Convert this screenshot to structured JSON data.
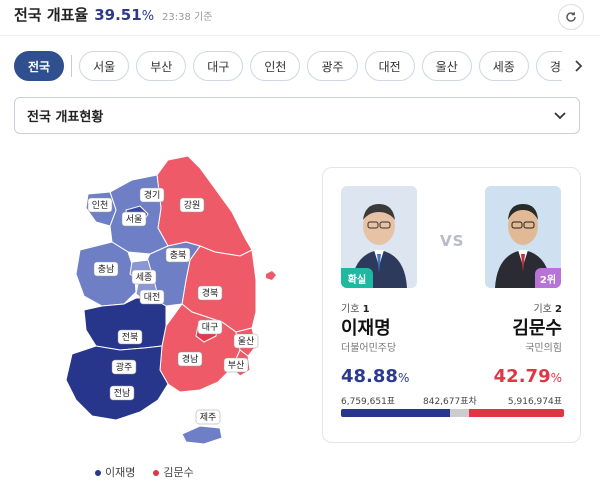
{
  "header": {
    "title": "전국 개표율",
    "rate": "39.51",
    "rate_unit": "%",
    "time": "23:38 기준"
  },
  "tabs": [
    {
      "label": "전국",
      "active": true
    },
    {
      "label": "서울"
    },
    {
      "label": "부산"
    },
    {
      "label": "대구"
    },
    {
      "label": "인천"
    },
    {
      "label": "광주"
    },
    {
      "label": "대전"
    },
    {
      "label": "울산"
    },
    {
      "label": "세종"
    },
    {
      "label": "경기"
    }
  ],
  "dropdown": {
    "label": "전국 개표현황"
  },
  "colors": {
    "blue": "#27368a",
    "blue_light": "#6e7fc6",
    "red": "#ee5a68",
    "red_light": "#f39aa3",
    "gray": "#cccccc"
  },
  "map": {
    "regions": [
      {
        "name": "인천",
        "winner": "blue"
      },
      {
        "name": "경기",
        "winner": "blue"
      },
      {
        "name": "서울",
        "winner": "blue"
      },
      {
        "name": "강원",
        "winner": "red"
      },
      {
        "name": "충남",
        "winner": "blue"
      },
      {
        "name": "세종",
        "winner": "blue"
      },
      {
        "name": "충북",
        "winner": "blue"
      },
      {
        "name": "대전",
        "winner": "blue"
      },
      {
        "name": "경북",
        "winner": "red"
      },
      {
        "name": "대구",
        "winner": "red"
      },
      {
        "name": "전북",
        "winner": "blue"
      },
      {
        "name": "울산",
        "winner": "red"
      },
      {
        "name": "광주",
        "winner": "blue"
      },
      {
        "name": "경남",
        "winner": "red"
      },
      {
        "name": "부산",
        "winner": "red"
      },
      {
        "name": "전남",
        "winner": "blue"
      },
      {
        "name": "제주",
        "winner": "blue"
      }
    ]
  },
  "legend": [
    {
      "label": "이재명",
      "color": "#27368a"
    },
    {
      "label": "김문수",
      "color": "#e03545"
    }
  ],
  "candidates": {
    "left": {
      "number_label": "기호",
      "number": "1",
      "name": "이재명",
      "party": "더불어민주당",
      "badge": "확실",
      "pct": "48.88",
      "pct_unit": "%",
      "votes": "6,759,651표",
      "share": 0.4888
    },
    "right": {
      "number_label": "기호",
      "number": "2",
      "name": "김문수",
      "party": "국민의힘",
      "badge": "2위",
      "pct": "42.79",
      "pct_unit": "%",
      "votes": "5,916,974표",
      "share": 0.4279
    },
    "diff": "842,677표차"
  }
}
